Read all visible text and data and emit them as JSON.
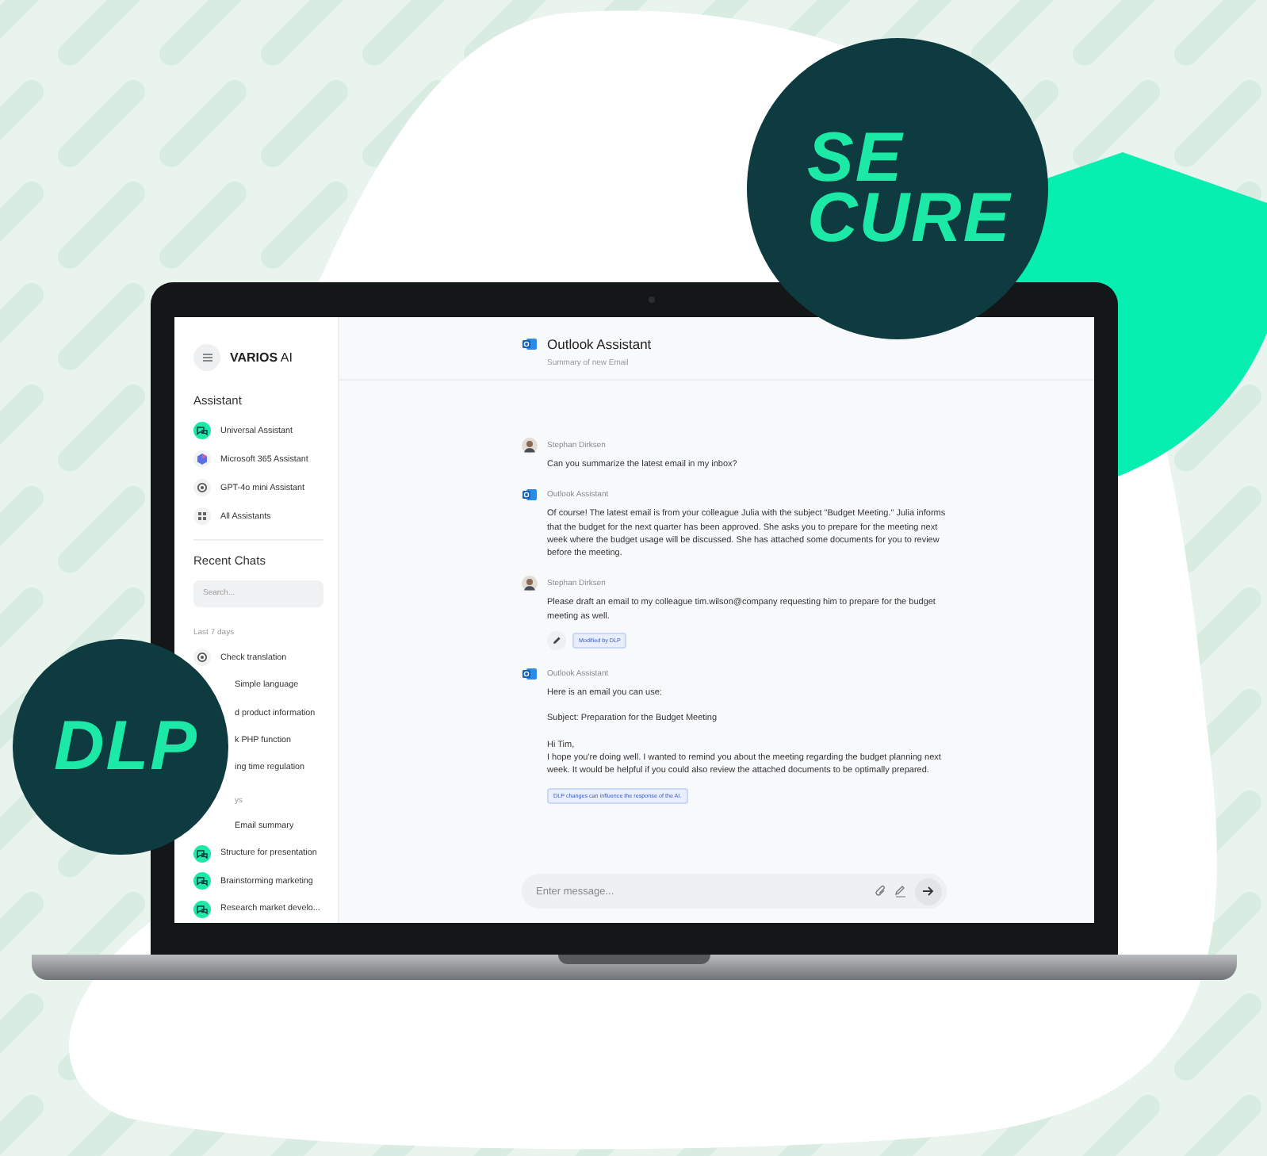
{
  "badges": [
    {
      "kind": "secure",
      "lines": [
        "SE",
        "CURE"
      ]
    },
    {
      "kind": "dlp",
      "lines": [
        "DLP"
      ]
    }
  ],
  "sidebar": {
    "brand_bold": "VARIOS",
    "brand_rest": "AI",
    "assistant_heading": "Assistant",
    "assistants": [
      {
        "label": "Universal Assistant",
        "kind": "chat"
      },
      {
        "label": "Microsoft 365 Assistant",
        "kind": "hexagon"
      },
      {
        "label": "GPT-4o mini Assistant",
        "kind": "flower"
      },
      {
        "label": "All Assistants",
        "kind": "grid"
      }
    ],
    "recent_heading": "Recent Chats",
    "search": {
      "placeholder": "Search..."
    },
    "groups": [
      {
        "label": "Last 7 days",
        "kind": "plain",
        "items": [
          {
            "label": "Check translation",
            "kind": "flower"
          },
          {
            "label": "Simple language",
            "kind": "covered"
          },
          {
            "label": "d product information",
            "kind": "covered"
          },
          {
            "label": "k PHP function",
            "kind": "covered"
          },
          {
            "label": "ing time regulation",
            "kind": "covered"
          }
        ]
      },
      {
        "label": "ys",
        "kind": "covered",
        "items": [
          {
            "label": "Email summary",
            "kind": "covered"
          },
          {
            "label": "Structure for presentation",
            "kind": "chat"
          },
          {
            "label": "Brainstorming marketing",
            "kind": "chat"
          },
          {
            "label": "Research market develo...",
            "kind": "chat"
          }
        ]
      }
    ]
  },
  "header": {
    "title": "Outlook Assistant",
    "subtitle": "Summary of new Email"
  },
  "messages": [
    {
      "kind": "user",
      "author": "Stephan Dirksen",
      "paragraphs": [
        [
          "Can you summarize the latest email in my inbox?"
        ]
      ]
    },
    {
      "kind": "assistant",
      "author": "Outlook Assistant",
      "paragraphs": [
        [
          "Of course! The latest email is from your colleague Julia with the subject \"Budget Meeting.\" Julia informs that the budget for the next quarter has been approved. She asks you to prepare for the meeting next week where the budget usage will be discussed. She has attached some documents for you to review before the meeting."
        ]
      ]
    },
    {
      "kind": "user",
      "author": "Stephan Dirksen",
      "paragraphs": [
        [
          "Please draft an email to my colleague tim.wilson@company requesting him to prepare for the budget meeting as well."
        ]
      ],
      "tag": "Modified by DLP"
    },
    {
      "kind": "assistant",
      "author": "Outlook Assistant",
      "paragraphs": [
        [
          "Here is an email you can use:"
        ],
        [
          "Subject: Preparation for the Budget Meeting"
        ],
        [
          "Hi Tim,",
          "I hope you're doing well. I wanted to remind you about the meeting regarding the budget planning next week. It would be helpful if you could also review the attached documents to be optimally prepared."
        ]
      ],
      "note": "DLP changes can influence the response of the AI."
    }
  ],
  "composer": {
    "placeholder": "Enter message..."
  }
}
